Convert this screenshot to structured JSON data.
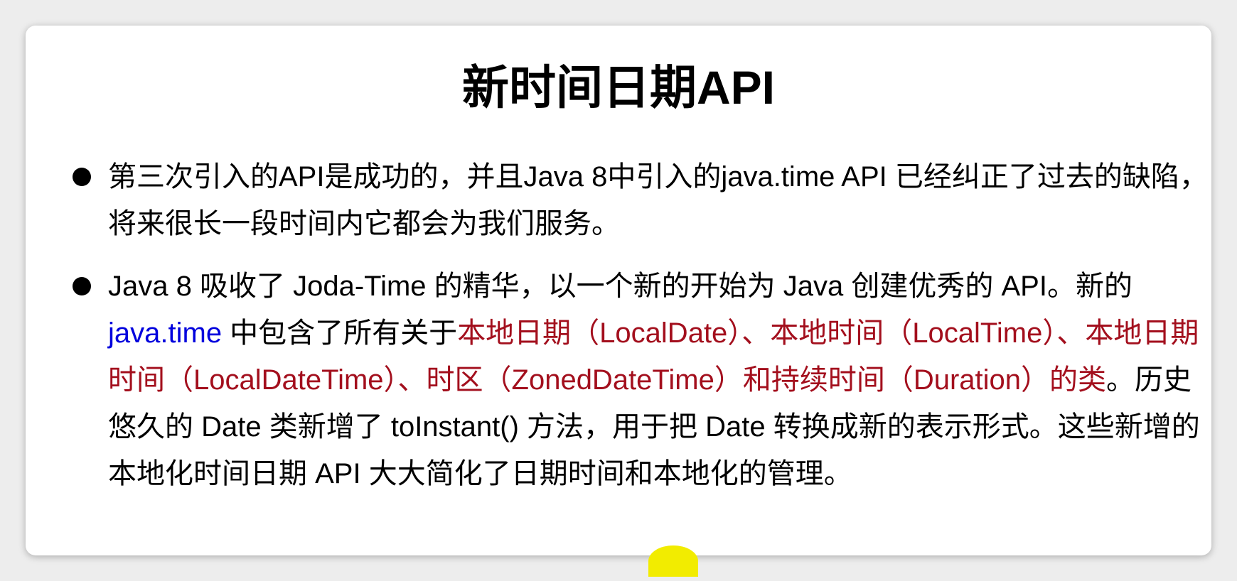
{
  "slide": {
    "title": "新时间日期API",
    "bullet1": {
      "text": "第三次引入的API是成功的，并且Java 8中引入的java.time API 已经纠正了过去的缺陷，将来很长一段时间内它都会为我们服务。"
    },
    "bullet2": {
      "part1": "Java 8 吸收了 Joda-Time 的精华，以一个新的开始为 Java 创建优秀的 API。新的 ",
      "highlight_blue": "java.time",
      "part2": " 中包含了所有关于",
      "highlight_red": "本地日期（LocalDate）、本地时间（LocalTime）、本地日期时间（LocalDateTime）、时区（ZonedDateTime）和持续时间（Duration）的类",
      "part3": "。历史悠久的 Date 类新增了 toInstant() 方法，用于把 Date 转换成新的表示形式。这些新增的本地化时间日期 API 大大简化了日期时间和本地化的管理。"
    }
  },
  "colors": {
    "highlight_blue": "#0000dd",
    "highlight_red": "#a30f1d",
    "cursor_marker": "#f2ec00"
  }
}
